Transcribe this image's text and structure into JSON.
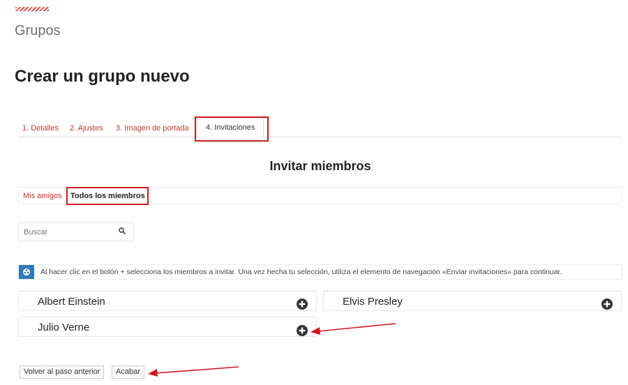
{
  "header": {
    "section_title": "Grupos",
    "page_title": "Crear un grupo nuevo"
  },
  "steps": [
    {
      "label": "1. Detalles",
      "active": false
    },
    {
      "label": "2. Ajustes",
      "active": false
    },
    {
      "label": "3. Imagen de portada",
      "active": false
    },
    {
      "label": "4. Invitaciones",
      "active": true
    }
  ],
  "invite": {
    "heading": "Invitar miembros",
    "tabs": [
      {
        "label": "Mis amigos",
        "active": false
      },
      {
        "label": "Todos los miembros",
        "active": true
      }
    ],
    "search": {
      "placeholder": "Buscar",
      "value": ""
    },
    "info": "Al hacer clic en el botón + selecciona los miembros a invitar. Una vez hecha tu selección, utiliza el elemento de navegación «Enviar invitaciones» para continuar.",
    "members": [
      {
        "name": "Albert Einstein"
      },
      {
        "name": "Elvis Presley"
      },
      {
        "name": "Julio Verne"
      }
    ]
  },
  "buttons": {
    "back_label": "Volver al paso anterior",
    "finish_label": "Acabar"
  },
  "colors": {
    "link_red": "#c0392b",
    "highlight_red": "#cc1a1a",
    "info_blue": "#2f7ab8",
    "add_icon": "#333333"
  },
  "icons": {
    "search": "search-icon",
    "info": "info-icon",
    "add": "plus-circle-icon"
  }
}
